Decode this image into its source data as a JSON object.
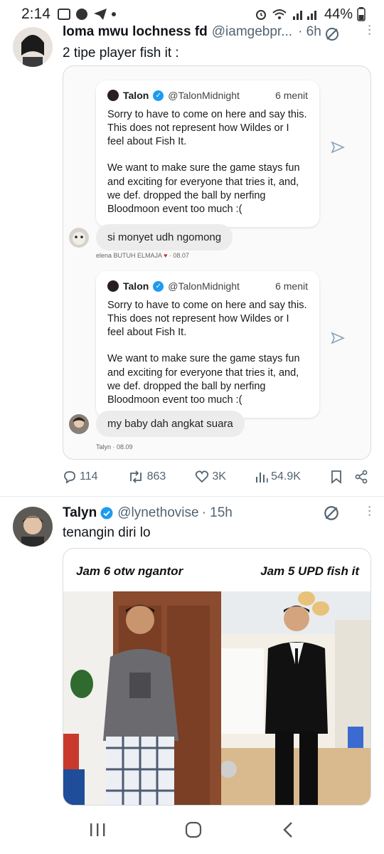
{
  "status_bar": {
    "time": "2:14",
    "battery": "44%"
  },
  "tweet1": {
    "display_name": "loma mwu lochness fd",
    "handle": "@iamgebpr...",
    "time": "· 6h",
    "text": "2 tipe player fish it :",
    "embed": {
      "card1": {
        "name": "Talon",
        "handle": "@TalonMidnight",
        "time": "6 menit",
        "para1": "Sorry to have to come on here and say this. This does not represent how Wildes or I feel about Fish It.",
        "para2": "We want to make sure the game stays fun and exciting for everyone that tries it, and, we def. dropped the ball by nerfing Bloodmoon event too much :("
      },
      "reply1": {
        "text": "si monyet udh ngomong",
        "meta_name": "elena BUTUH ELMAJA",
        "meta_time": "· 08.07"
      },
      "card2": {
        "name": "Talon",
        "handle": "@TalonMidnight",
        "time": "6 menit",
        "para1": "Sorry to have to come on here and say this. This does not represent how Wildes or I feel about Fish It.",
        "para2": "We want to make sure the game stays fun and exciting for everyone that tries it, and, we def. dropped the ball by nerfing Bloodmoon event too much :("
      },
      "reply2": {
        "text": "my baby dah angkat suara",
        "meta_name": "Talyn",
        "meta_time": "· 08.09"
      }
    },
    "actions": {
      "replies": "114",
      "reposts": "863",
      "likes": "3K",
      "views": "54.9K"
    }
  },
  "tweet2": {
    "display_name": "Talyn",
    "handle": "@lynethovise",
    "time": "· 15h",
    "text": "tenangin diri lo",
    "media": {
      "caption_left": "Jam 6 otw ngantor",
      "caption_right": "Jam 5 UPD fish it"
    }
  },
  "colors": {
    "verified": "#1d9bf0",
    "secondary_text": "#536471"
  }
}
